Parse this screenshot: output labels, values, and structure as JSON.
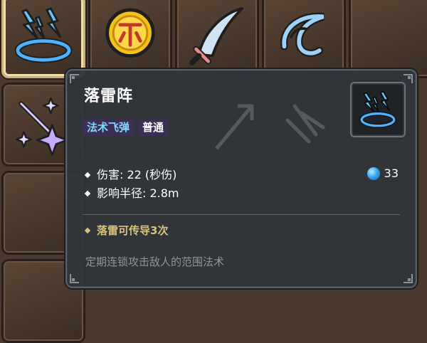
{
  "tooltip": {
    "title": "落雷阵",
    "tags": {
      "type": "法术飞弹",
      "rarity": "普通"
    },
    "stats": [
      {
        "label": "伤害: 22 (秒伤)"
      },
      {
        "label": "影响半径: 2.8m"
      }
    ],
    "mana_cost": "33",
    "bonus": "落雷可传导3次",
    "description": "定期连锁攻击敌人的范围法术"
  },
  "inventory": {
    "slots": [
      {
        "icon": "lightning-circle-icon",
        "selected": true
      },
      {
        "icon": "gold-coin-icon"
      },
      {
        "icon": "curved-sword-icon"
      },
      {
        "icon": "wind-swirl-icon"
      },
      {
        "icon": "sparkle-stars-icon"
      }
    ]
  },
  "colors": {
    "type_tag": "#7fd6ff",
    "bonus_text": "#d9c27a",
    "mana": "#38a8f0"
  }
}
